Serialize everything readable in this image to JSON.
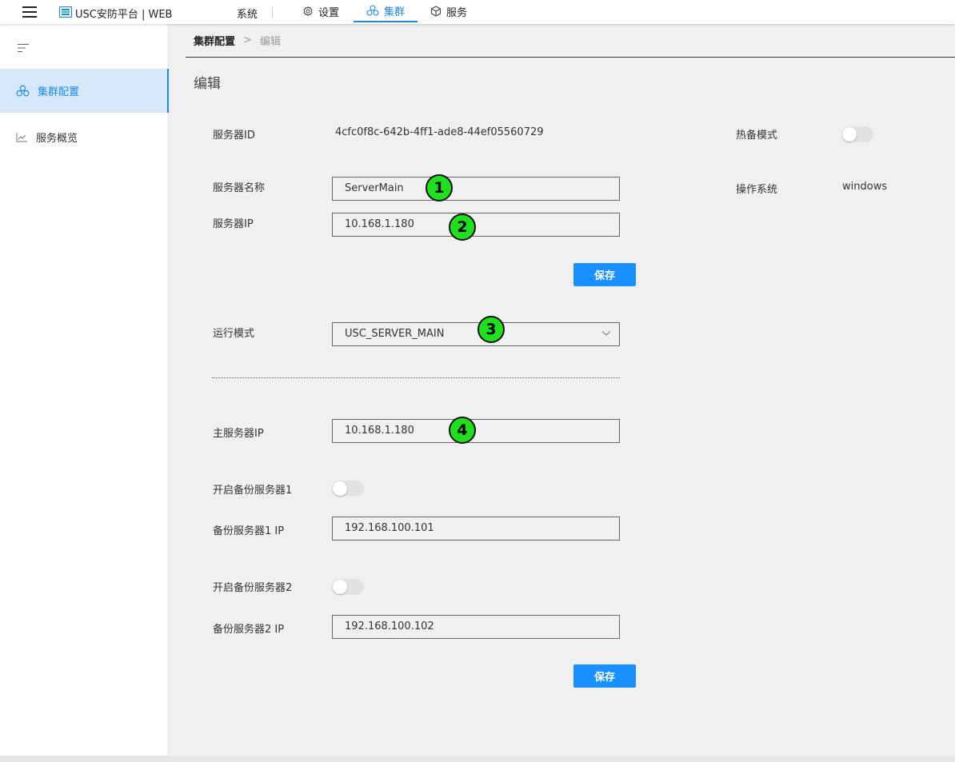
{
  "header": {
    "app_title": "USC安防平台 | WEB",
    "nav": {
      "system": "系统",
      "tabs": [
        {
          "label": "设置",
          "icon": "gear-icon"
        },
        {
          "label": "集群",
          "icon": "cluster-icon",
          "active": true
        },
        {
          "label": "服务",
          "icon": "cube-icon"
        }
      ]
    }
  },
  "sidebar": {
    "items": [
      {
        "label": "集群配置",
        "icon": "cluster-icon",
        "active": true
      },
      {
        "label": "服务概览",
        "icon": "line-chart-icon"
      }
    ]
  },
  "breadcrumb": {
    "current": "集群配置",
    "separator": ">",
    "sub": "编辑"
  },
  "page": {
    "title": "编辑"
  },
  "server": {
    "id_label": "服务器ID",
    "id_value": "4cfc0f8c-642b-4ff1-ade8-44ef05560729",
    "hot_standby_label": "热备模式",
    "os_label": "操作系统",
    "os_value": "windows",
    "name_label": "服务器名称",
    "name_value": "ServerMain",
    "ip_label": "服务器IP",
    "ip_value": "10.168.1.180",
    "save_label": "保存"
  },
  "run": {
    "mode_label": "运行模式",
    "mode_value": "USC_SERVER_MAIN",
    "main_ip_label": "主服务器IP",
    "main_ip_value": "10.168.1.180",
    "backup1_enable_label": "开启备份服务器1",
    "backup1_ip_label": "备份服务器1 IP",
    "backup1_ip_value": "192.168.100.101",
    "backup2_enable_label": "开启备份服务器2",
    "backup2_ip_label": "备份服务器2 IP",
    "backup2_ip_value": "192.168.100.102",
    "save_label": "保存"
  },
  "markers": [
    "1",
    "2",
    "3",
    "4"
  ],
  "colors": {
    "accent": "#1e88e5",
    "button": "#1890ff",
    "marker": "#1fe01f",
    "active_bg": "#d5e9fb"
  }
}
